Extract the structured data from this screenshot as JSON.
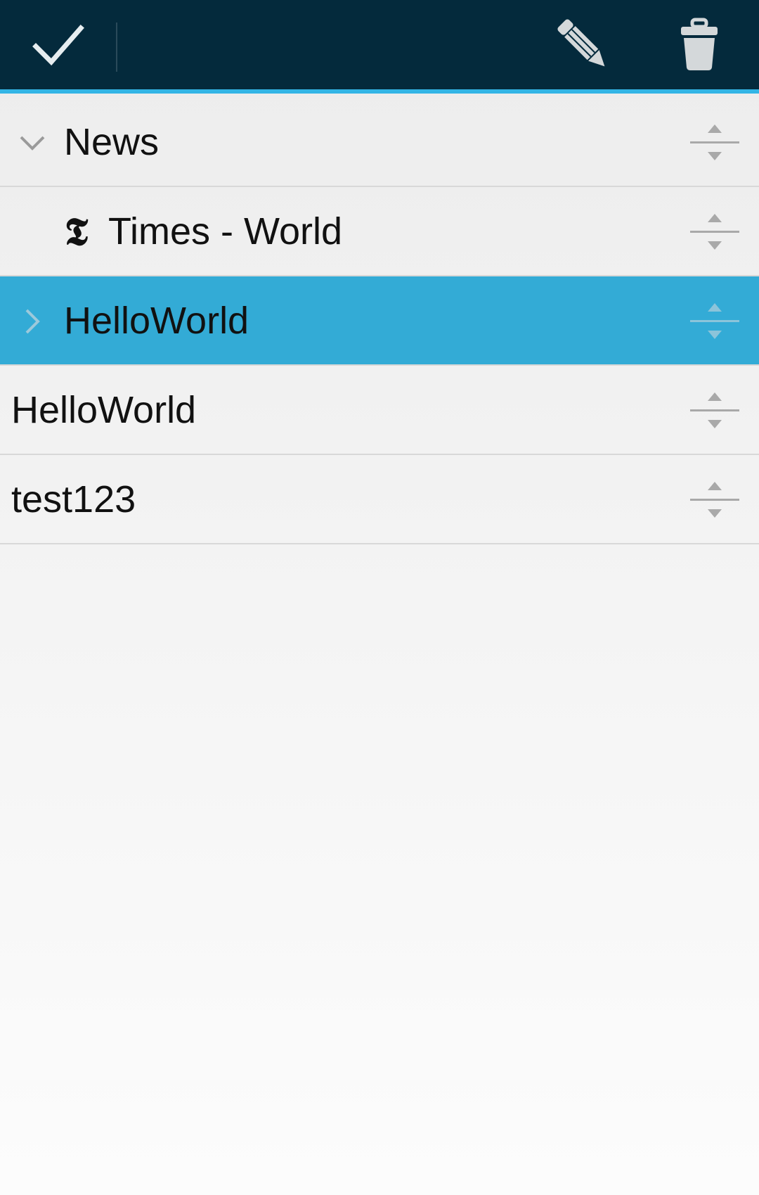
{
  "action_bar": {
    "done_icon": "checkmark-icon",
    "edit_icon": "pencil-icon",
    "delete_icon": "trash-icon",
    "background_color": "#042a3c",
    "accent_color": "#33b5e5"
  },
  "list": {
    "items": [
      {
        "label": "News",
        "level": 0,
        "type": "folder",
        "expanded": true,
        "selected": false
      },
      {
        "label": "Times - World",
        "level": 1,
        "type": "feed",
        "icon_glyph": "𝕿",
        "selected": false
      },
      {
        "label": "HelloWorld",
        "level": 0,
        "type": "folder",
        "expanded": false,
        "selected": true
      },
      {
        "label": "HelloWorld",
        "level": 0,
        "type": "feed",
        "selected": false
      },
      {
        "label": "test123",
        "level": 0,
        "type": "feed",
        "selected": false
      }
    ],
    "selected_color": "#33abd6",
    "drag_handle_icon": "drag-handle-icon"
  }
}
